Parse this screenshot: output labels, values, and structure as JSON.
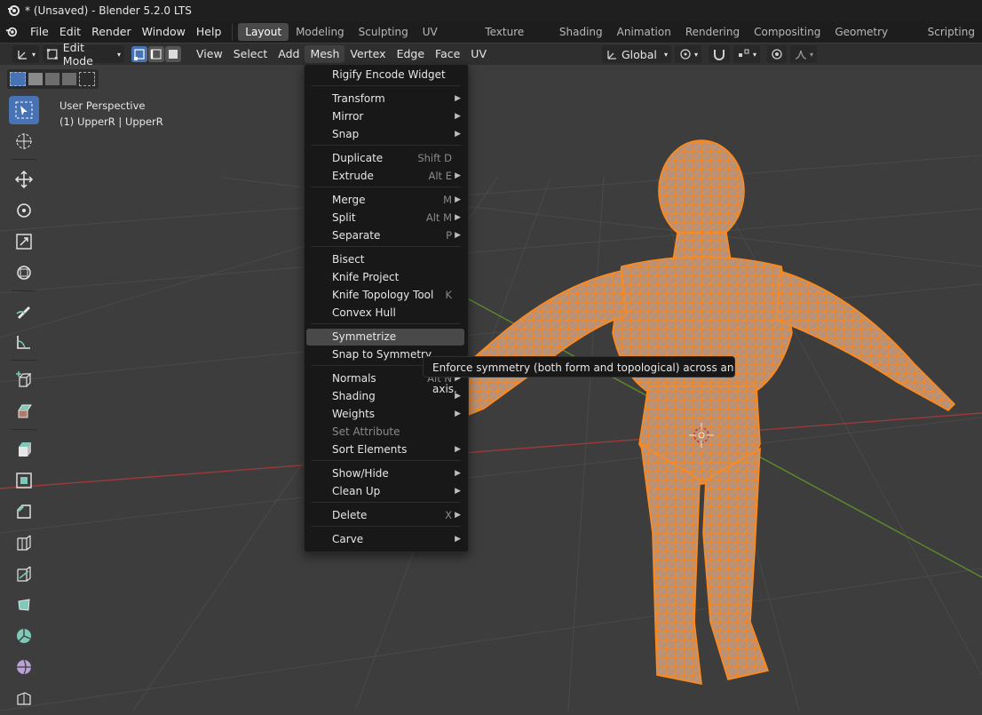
{
  "window": {
    "title": "* (Unsaved) - Blender 5.2.0 LTS"
  },
  "topbar": {
    "menus": [
      "File",
      "Edit",
      "Render",
      "Window",
      "Help"
    ],
    "workspaces": [
      "Layout",
      "Modeling",
      "Sculpting",
      "UV Editing",
      "Texture Paint",
      "Shading",
      "Animation",
      "Rendering",
      "Compositing",
      "Geometry Nodes",
      "Scripting"
    ],
    "active_workspace": "Layout"
  },
  "header": {
    "mode": "Edit Mode",
    "menus": [
      "View",
      "Select",
      "Add",
      "Mesh",
      "Vertex",
      "Edge",
      "Face",
      "UV"
    ],
    "open_menu": "Mesh",
    "orientation": "Global"
  },
  "viewport": {
    "perspective": "User Perspective",
    "object": "(1) UpperR | UpperR"
  },
  "mesh_menu": {
    "items": [
      {
        "label": "Rigify Encode Widget",
        "shortcut": "",
        "submenu": false
      },
      {
        "label": "Transform",
        "shortcut": "",
        "submenu": true
      },
      {
        "label": "Mirror",
        "shortcut": "",
        "submenu": true
      },
      {
        "label": "Snap",
        "shortcut": "",
        "submenu": true
      },
      {
        "label": "Duplicate",
        "shortcut": "Shift D",
        "submenu": false
      },
      {
        "label": "Extrude",
        "shortcut": "Alt E",
        "submenu": true
      },
      {
        "label": "Merge",
        "shortcut": "M",
        "submenu": true
      },
      {
        "label": "Split",
        "shortcut": "Alt M",
        "submenu": true
      },
      {
        "label": "Separate",
        "shortcut": "P",
        "submenu": true
      },
      {
        "label": "Bisect",
        "shortcut": "",
        "submenu": false
      },
      {
        "label": "Knife Project",
        "shortcut": "",
        "submenu": false
      },
      {
        "label": "Knife Topology Tool",
        "shortcut": "K",
        "submenu": false
      },
      {
        "label": "Convex Hull",
        "shortcut": "",
        "submenu": false
      },
      {
        "label": "Symmetrize",
        "shortcut": "",
        "submenu": false
      },
      {
        "label": "Snap to Symmetry",
        "shortcut": "",
        "submenu": false
      },
      {
        "label": "Normals",
        "shortcut": "Alt N",
        "submenu": true
      },
      {
        "label": "Shading",
        "shortcut": "",
        "submenu": true
      },
      {
        "label": "Weights",
        "shortcut": "",
        "submenu": true
      },
      {
        "label": "Set Attribute",
        "shortcut": "",
        "submenu": false
      },
      {
        "label": "Sort Elements",
        "shortcut": "",
        "submenu": true
      },
      {
        "label": "Show/Hide",
        "shortcut": "",
        "submenu": true
      },
      {
        "label": "Clean Up",
        "shortcut": "",
        "submenu": true
      },
      {
        "label": "Delete",
        "shortcut": "X",
        "submenu": true
      },
      {
        "label": "Carve",
        "shortcut": "",
        "submenu": true
      }
    ],
    "highlighted": "Symmetrize",
    "disabled": "Set Attribute"
  },
  "tooltip": {
    "text": "Enforce symmetry (both form and topological) across an axis."
  },
  "colors": {
    "accent": "#4772b3",
    "mesh_wire": "#ff8c1a",
    "mesh_fill": "#b09080",
    "x_axis": "#9b3a3a",
    "y_axis": "#5e8c2a"
  }
}
